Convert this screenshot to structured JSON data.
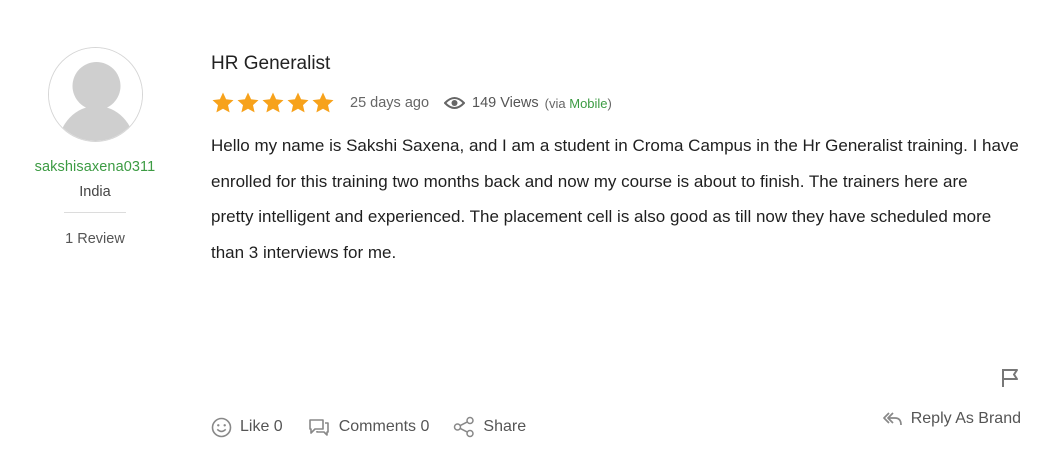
{
  "reviewer": {
    "username": "sakshisaxena0311",
    "country": "India",
    "review_count": "1 Review"
  },
  "review": {
    "title": "HR Generalist",
    "rating": 5,
    "date": "25 days ago",
    "views": "149 Views",
    "via_prefix": "(via",
    "via_source": "Mobile",
    "via_suffix": ")",
    "paragraphs": [
      "Hello my name is Sakshi Saxena, and I am a student in Croma Campus in the Hr Generalist training. I have",
      "enrolled for this training two months back and now my course is about to finish. The trainers here are",
      "pretty intelligent and experienced. The placement cell is also good as till now they have scheduled more",
      "than 3 interviews for me."
    ]
  },
  "actions": {
    "like": "Like 0",
    "comments": "Comments 0",
    "share": "Share",
    "reply_as_brand": "Reply As Brand"
  },
  "colors": {
    "star": "#f7a21b",
    "accent_green": "#3c9b43",
    "icon_gray": "#888888"
  },
  "icons": [
    "avatar-placeholder",
    "star-icon",
    "eye-icon",
    "flag-icon",
    "smiley-icon",
    "comment-icon",
    "share-icon",
    "reply-icon"
  ]
}
